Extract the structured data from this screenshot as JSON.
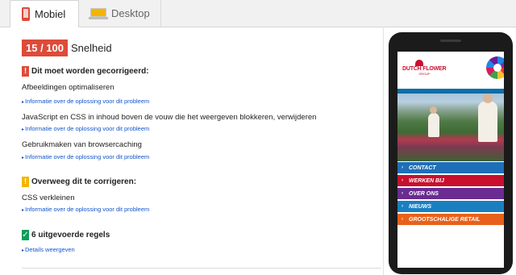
{
  "tabs": [
    {
      "label": "Mobiel",
      "icon": "mobile-phone-icon",
      "active": true
    },
    {
      "label": "Desktop",
      "icon": "desktop-monitor-icon",
      "active": false
    }
  ],
  "score": {
    "value": "15 / 100",
    "label": "Snelheid",
    "color": "#dd4b39"
  },
  "sections": {
    "must_fix": {
      "heading": "Dit moet worden gecorrigeerd:",
      "items": [
        {
          "text": "Afbeeldingen optimaliseren",
          "link": "Informatie over de oplossing voor dit probleem"
        },
        {
          "text": "JavaScript en CSS in inhoud boven de vouw die het weergeven blokkeren, verwijderen",
          "link": "Informatie over de oplossing voor dit probleem"
        },
        {
          "text": "Gebruikmaken van browsercaching",
          "link": "Informatie over de oplossing voor dit probleem"
        }
      ]
    },
    "consider_fix": {
      "heading": "Overweeg dit te corrigeren:",
      "items": [
        {
          "text": "CSS verkleinen",
          "link": "Informatie over de oplossing voor dit probleem"
        }
      ]
    },
    "passed": {
      "heading": "6 uitgevoerde regels",
      "link": "Details weergeven"
    }
  },
  "preview": {
    "logo": "DUTCH FLOWER",
    "logo_sub": "GROUP",
    "menu": [
      {
        "label": "CONTACT",
        "color": "#1e6fb8"
      },
      {
        "label": "WERKEN BIJ",
        "color": "#c8102e"
      },
      {
        "label": "OVER ONS",
        "color": "#6a2c91"
      },
      {
        "label": "NIEUWS",
        "color": "#1a7fc1"
      },
      {
        "label": "GROOTSCHALIGE RETAIL",
        "color": "#e8611a"
      }
    ]
  }
}
